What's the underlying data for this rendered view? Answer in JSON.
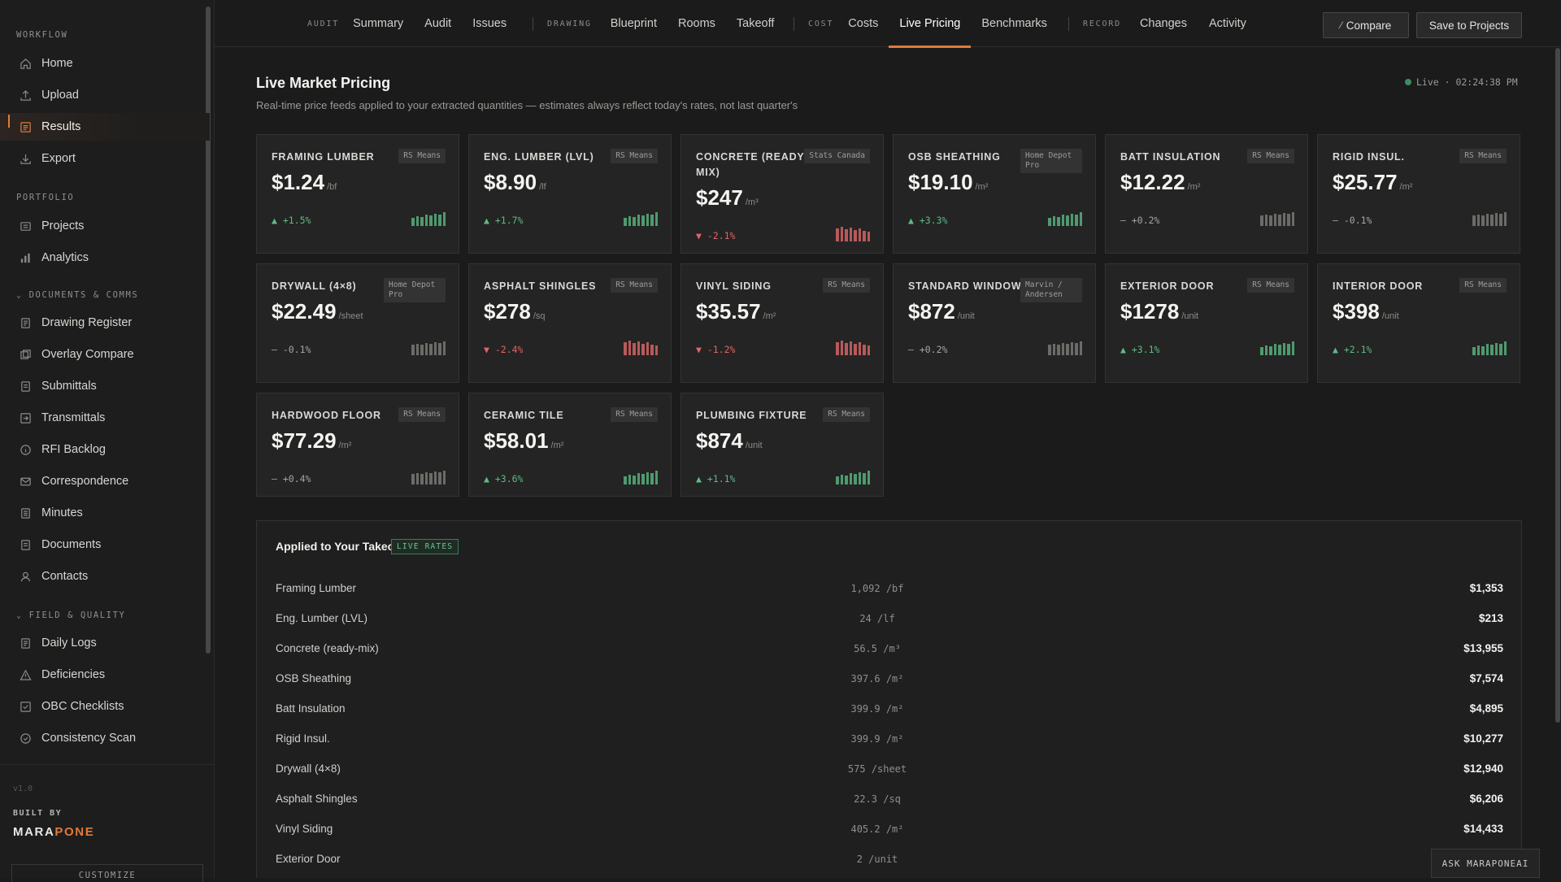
{
  "sidebar": {
    "workflow_heading": "WORKFLOW",
    "workflow": [
      {
        "label": "Home",
        "icon": "home-icon"
      },
      {
        "label": "Upload",
        "icon": "upload-icon"
      },
      {
        "label": "Results",
        "icon": "results-icon",
        "active": true
      },
      {
        "label": "Export",
        "icon": "export-icon"
      }
    ],
    "portfolio_heading": "PORTFOLIO",
    "portfolio": [
      {
        "label": "Projects"
      },
      {
        "label": "Analytics"
      }
    ],
    "docs_heading": "DOCUMENTS & COMMS",
    "docs": [
      {
        "label": "Drawing Register"
      },
      {
        "label": "Overlay Compare"
      },
      {
        "label": "Submittals"
      },
      {
        "label": "Transmittals"
      },
      {
        "label": "RFI Backlog"
      },
      {
        "label": "Correspondence"
      },
      {
        "label": "Minutes"
      },
      {
        "label": "Documents"
      },
      {
        "label": "Contacts"
      }
    ],
    "field_heading": "FIELD & QUALITY",
    "field": [
      {
        "label": "Daily Logs"
      },
      {
        "label": "Deficiencies"
      },
      {
        "label": "OBC Checklists"
      },
      {
        "label": "Consistency Scan"
      }
    ],
    "version": "v1.0",
    "built_by": "BUILT BY",
    "brand_a": "MARA",
    "brand_b": "PONE",
    "customize": "CUSTOMIZE"
  },
  "topnav": {
    "groups": [
      {
        "label": "AUDIT",
        "tabs": [
          "Summary",
          "Audit",
          "Issues"
        ]
      },
      {
        "label": "DRAWING",
        "tabs": [
          "Blueprint",
          "Rooms",
          "Takeoff"
        ]
      },
      {
        "label": "COST",
        "tabs": [
          "Costs",
          "Live Pricing",
          "Benchmarks"
        ]
      },
      {
        "label": "RECORD",
        "tabs": [
          "Changes",
          "Activity"
        ]
      }
    ],
    "active_tab": "Live Pricing",
    "compare_label": "Compare",
    "save_label": "Save to Projects"
  },
  "page": {
    "title": "Live Market Pricing",
    "subtitle": "Real-time price feeds applied to your extracted quantities — estimates always reflect today's rates, not last quarter's",
    "live_label": "Live · 02:24:38 PM"
  },
  "cards": [
    {
      "name": "FRAMING LUMBER",
      "source": "RS Means",
      "price": "$1.24",
      "unit": "/bf",
      "change": "▲ +1.5%",
      "trend": "up"
    },
    {
      "name": "ENG. LUMBER (LVL)",
      "source": "RS Means",
      "price": "$8.90",
      "unit": "/lf",
      "change": "▲ +1.7%",
      "trend": "up"
    },
    {
      "name": "CONCRETE (READY-MIX)",
      "source": "Stats Canada",
      "price": "$247",
      "unit": "/m³",
      "change": "▼ -2.1%",
      "trend": "down"
    },
    {
      "name": "OSB SHEATHING",
      "source": "Home Depot Pro",
      "price": "$19.10",
      "unit": "/m²",
      "change": "▲ +3.3%",
      "trend": "up"
    },
    {
      "name": "BATT INSULATION",
      "source": "RS Means",
      "price": "$12.22",
      "unit": "/m²",
      "change": "— +0.2%",
      "trend": "flat"
    },
    {
      "name": "RIGID INSUL.",
      "source": "RS Means",
      "price": "$25.77",
      "unit": "/m²",
      "change": "— -0.1%",
      "trend": "flat"
    },
    {
      "name": "DRYWALL (4×8)",
      "source": "Home Depot Pro",
      "price": "$22.49",
      "unit": "/sheet",
      "change": "— -0.1%",
      "trend": "flat"
    },
    {
      "name": "ASPHALT SHINGLES",
      "source": "RS Means",
      "price": "$278",
      "unit": "/sq",
      "change": "▼ -2.4%",
      "trend": "down"
    },
    {
      "name": "VINYL SIDING",
      "source": "RS Means",
      "price": "$35.57",
      "unit": "/m²",
      "change": "▼ -1.2%",
      "trend": "down"
    },
    {
      "name": "STANDARD WINDOW",
      "source": "Marvin / Andersen",
      "price": "$872",
      "unit": "/unit",
      "change": "— +0.2%",
      "trend": "flat"
    },
    {
      "name": "EXTERIOR DOOR",
      "source": "RS Means",
      "price": "$1278",
      "unit": "/unit",
      "change": "▲ +3.1%",
      "trend": "up"
    },
    {
      "name": "INTERIOR DOOR",
      "source": "RS Means",
      "price": "$398",
      "unit": "/unit",
      "change": "▲ +2.1%",
      "trend": "up"
    },
    {
      "name": "HARDWOOD FLOOR",
      "source": "RS Means",
      "price": "$77.29",
      "unit": "/m²",
      "change": "— +0.4%",
      "trend": "flat"
    },
    {
      "name": "CERAMIC TILE",
      "source": "RS Means",
      "price": "$58.01",
      "unit": "/m²",
      "change": "▲ +3.6%",
      "trend": "up"
    },
    {
      "name": "PLUMBING FIXTURE",
      "source": "RS Means",
      "price": "$874",
      "unit": "/unit",
      "change": "▲ +1.1%",
      "trend": "up"
    }
  ],
  "takeoff": {
    "title": "Applied to Your Takeoff",
    "badge": "LIVE RATES",
    "rows": [
      {
        "name": "Framing Lumber",
        "qty": "1,092 /bf",
        "cost": "$1,353"
      },
      {
        "name": "Eng. Lumber (LVL)",
        "qty": "24 /lf",
        "cost": "$213"
      },
      {
        "name": "Concrete (ready-mix)",
        "qty": "56.5 /m³",
        "cost": "$13,955"
      },
      {
        "name": "OSB Sheathing",
        "qty": "397.6 /m²",
        "cost": "$7,574"
      },
      {
        "name": "Batt Insulation",
        "qty": "399.9 /m²",
        "cost": "$4,895"
      },
      {
        "name": "Rigid Insul.",
        "qty": "399.9 /m²",
        "cost": "$10,277"
      },
      {
        "name": "Drywall (4×8)",
        "qty": "575 /sheet",
        "cost": "$12,940"
      },
      {
        "name": "Asphalt Shingles",
        "qty": "22.3 /sq",
        "cost": "$6,206"
      },
      {
        "name": "Vinyl Siding",
        "qty": "405.2 /m²",
        "cost": "$14,433"
      },
      {
        "name": "Exterior Door",
        "qty": "2 /unit",
        "cost": ""
      }
    ]
  },
  "ask_label": "ASK MARAPONEAI"
}
